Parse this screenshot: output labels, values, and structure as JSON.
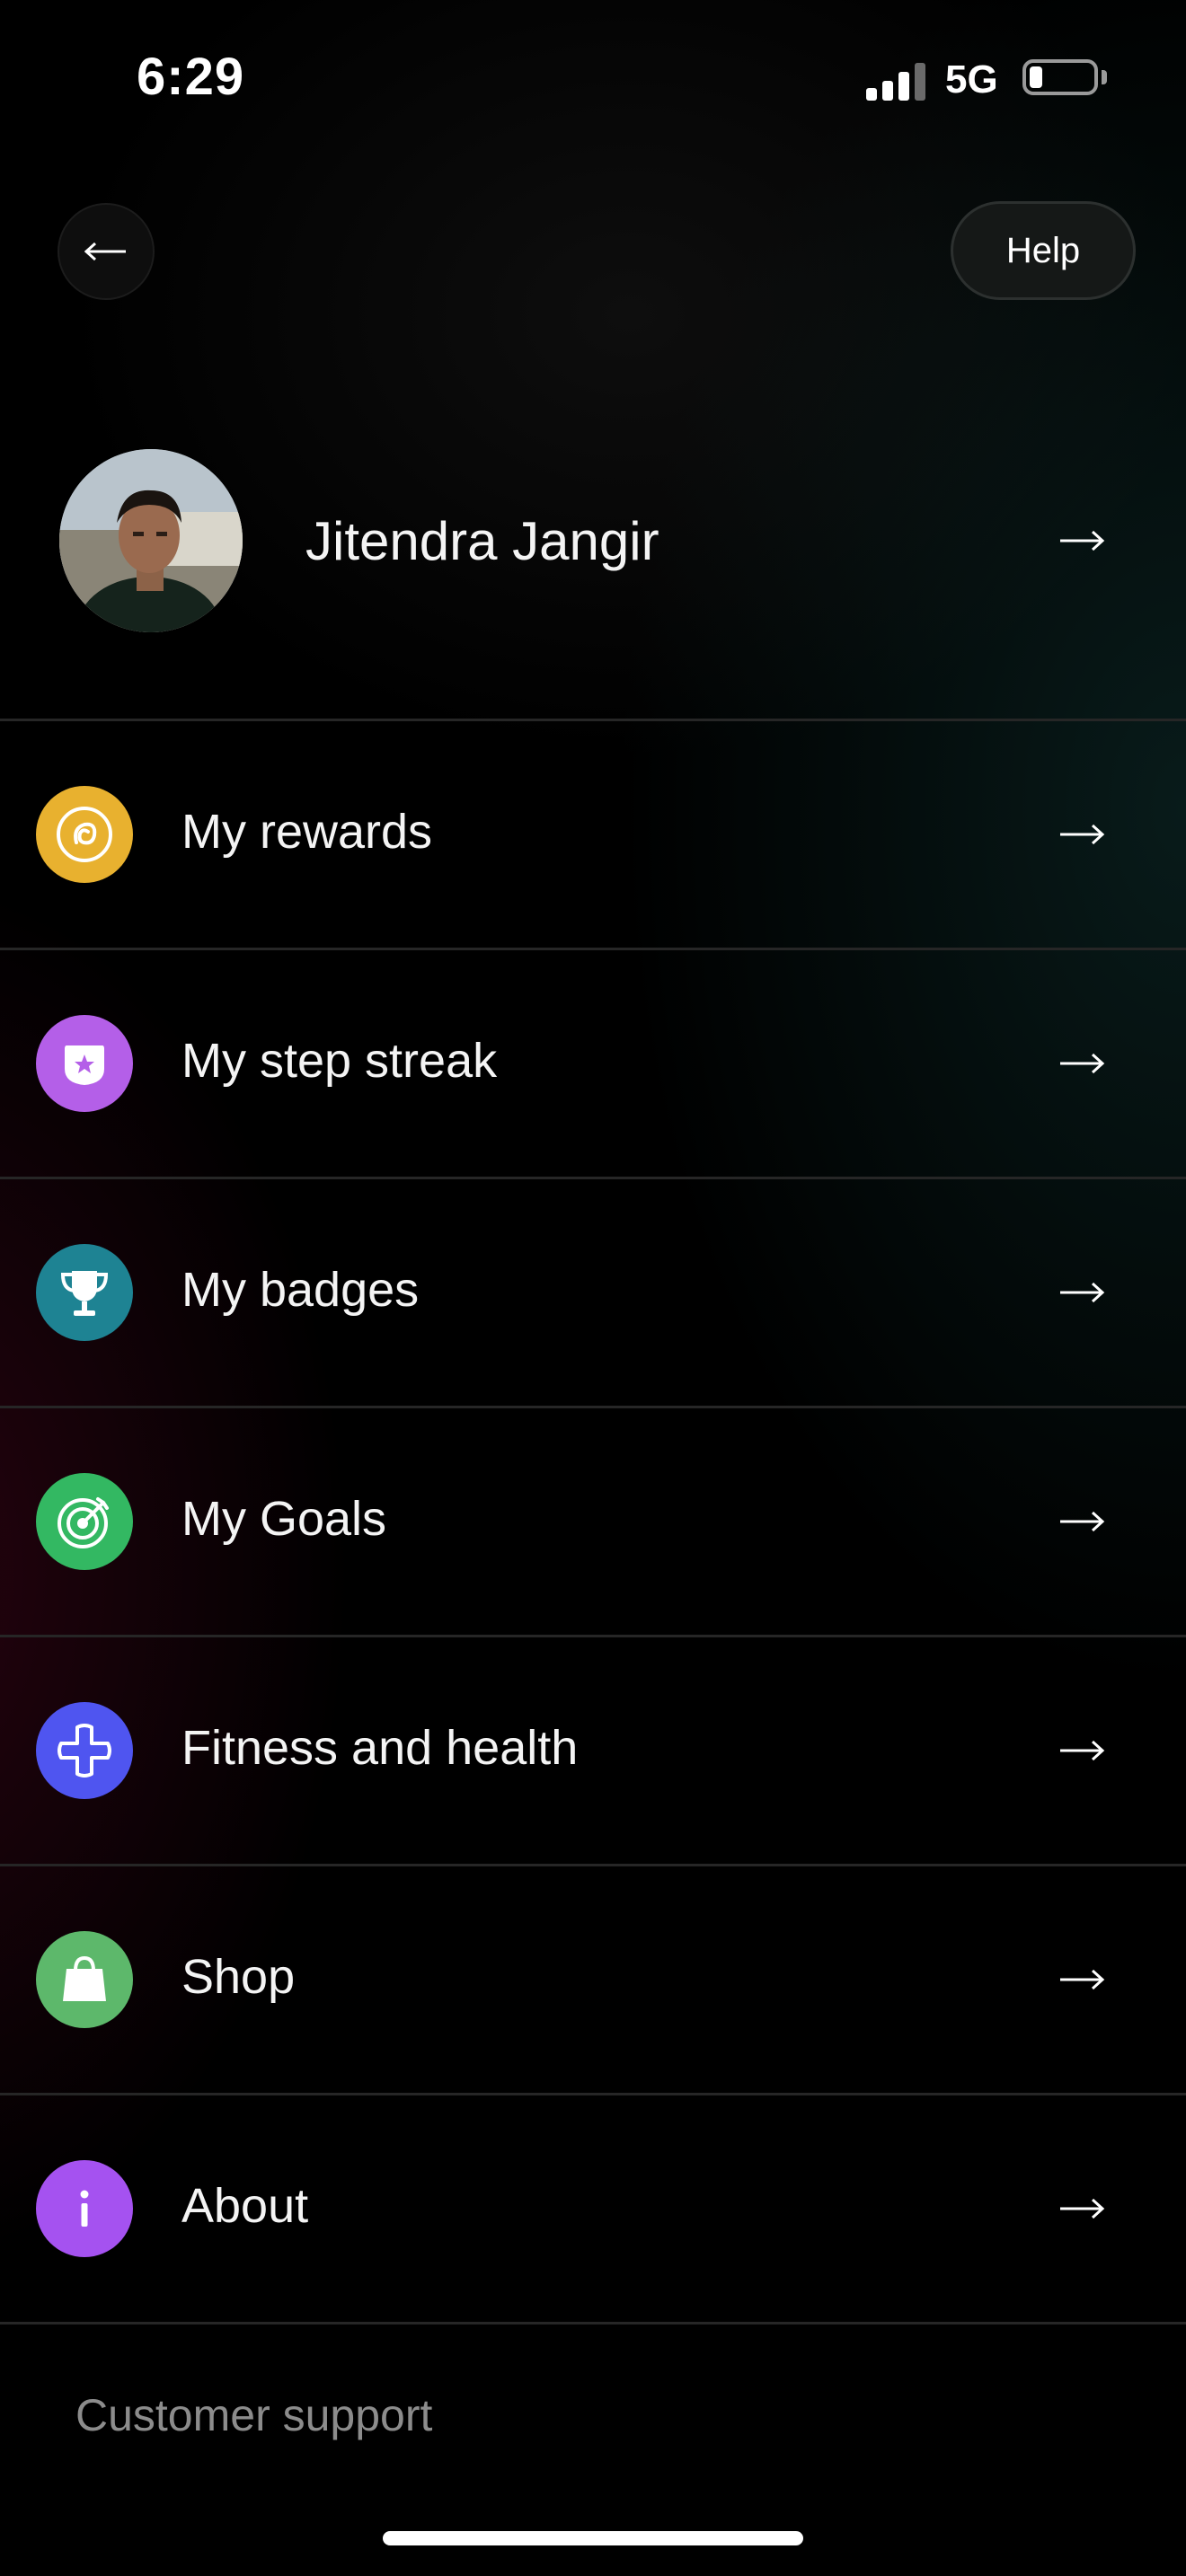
{
  "status_bar": {
    "time": "6:29",
    "network": "5G",
    "battery_level": 0.2,
    "signal_bars": 3
  },
  "header": {
    "help_label": "Help"
  },
  "profile": {
    "name": "Jitendra Jangir"
  },
  "menu": {
    "items": [
      {
        "label": "My rewards",
        "icon": "rewards-coin-icon",
        "color": "#E8B12F"
      },
      {
        "label": "My step streak",
        "icon": "streak-badge-icon",
        "color": "#B45FE8"
      },
      {
        "label": "My badges",
        "icon": "trophy-icon",
        "color": "#1E8393"
      },
      {
        "label": "My Goals",
        "icon": "target-icon",
        "color": "#33B862"
      },
      {
        "label": "Fitness and health",
        "icon": "health-cross-icon",
        "color": "#4F55F0"
      },
      {
        "label": "Shop",
        "icon": "shopping-bag-icon",
        "color": "#5DB86B"
      },
      {
        "label": "About",
        "icon": "info-icon",
        "color": "#A552F0"
      }
    ]
  },
  "footer": {
    "support_label": "Customer support"
  }
}
